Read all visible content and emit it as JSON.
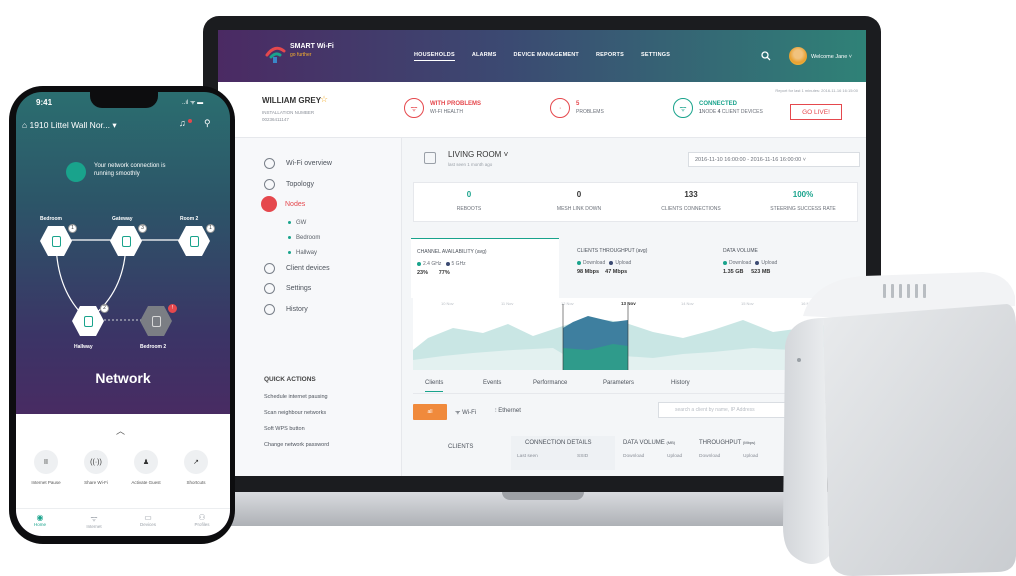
{
  "colors": {
    "accent": "#19a38c",
    "alert": "#e5484d",
    "brand_gradient_start": "#4b2a63",
    "brand_gradient_end": "#2f8277",
    "filter_orange": "#f08a3c"
  },
  "app": {
    "brand_name": "SMART Wi-Fi",
    "brand_tagline": "go further",
    "nav": [
      "HOUSEHOLDS",
      "ALARMS",
      "DEVICE MANAGEMENT",
      "REPORTS",
      "SETTINGS"
    ],
    "active_nav": "HOUSEHOLDS",
    "welcome": "Welcome Jane ˅",
    "search_icon": "search-icon"
  },
  "household": {
    "name": "WILLIAM GREY",
    "installation_label": "INSTALLATION NUMBER",
    "installation_number": "00236411147",
    "reported": "Report for last 1 minutes: 2016-11-16 16:15:00",
    "status_problems": {
      "title": "WITH PROBLEMS",
      "sub": "WI-FI HEALTH",
      "icon": "wifi-icon"
    },
    "status_count": {
      "title": "5",
      "sub": "PROBLEMS",
      "icon": "alert-icon"
    },
    "status_connected": {
      "title": "CONNECTED",
      "sub_nodes": "1",
      "sub_nodes_label": "NODE",
      "sub_clients": "4",
      "sub_clients_label": "CLIENT DEVICES",
      "icon": "wifi-icon"
    },
    "go_live": "GO LIVE!"
  },
  "sidebar": {
    "items": [
      {
        "label": "Wi-Fi overview",
        "icon": "clock-icon"
      },
      {
        "label": "Topology",
        "icon": "topology-icon"
      },
      {
        "label": "Nodes",
        "icon": "node-icon"
      },
      {
        "label": "Client devices",
        "icon": "phone-icon"
      },
      {
        "label": "Settings",
        "icon": "sliders-icon"
      },
      {
        "label": "History",
        "icon": "history-icon"
      }
    ],
    "active": "Nodes",
    "node_children": [
      "GW",
      "Bedroom",
      "Hallway"
    ],
    "quick_actions_title": "QUICK ACTIONS",
    "quick_actions": [
      "Schedule internet pausing",
      "Scan neighbour networks",
      "Soft WPS button",
      "Change network password"
    ]
  },
  "room": {
    "icon_label": "router",
    "name": "LIVING ROOM ˅",
    "last_seen": "last seen 1 month ago",
    "date_range": "2016-11-10 16:00:00 - 2016-11-16 16:00:00 ˅"
  },
  "kpis": [
    {
      "value": "0",
      "label": "REBOOTS"
    },
    {
      "value": "0",
      "label": "MESH LINK DOWN"
    },
    {
      "value": "133",
      "label": "CLIENTS CONNECTIONS"
    },
    {
      "value": "100%",
      "label": "STEERING SUCCESS RATE"
    }
  ],
  "charts": [
    {
      "title": "CHANNEL AVAILABILITY (avg)",
      "legend": [
        "2.4 GHz",
        "5 GHz"
      ],
      "values": [
        "23%",
        "77%"
      ]
    },
    {
      "title": "CLIENTS THROUGHPUT (avg)",
      "legend": [
        "Download",
        "Upload"
      ],
      "values": [
        "98 Mbps",
        "47 Mbps"
      ]
    },
    {
      "title": "DATA VOLUME",
      "legend": [
        "Download",
        "Upload"
      ],
      "values": [
        "1.35 GB",
        "523 MB"
      ]
    }
  ],
  "chart_ticks": [
    "10 Nov",
    "11 Nov",
    "12 Nov",
    "13 Nov",
    "14 Nov",
    "15 Nov",
    "16 Nov"
  ],
  "chart_highlight_tick": "13 Nov",
  "subtabs": [
    "Clients",
    "Events",
    "Performance",
    "Parameters",
    "History"
  ],
  "filters": {
    "all": "all",
    "wifi": "Wi-Fi",
    "ethernet": "Ethernet"
  },
  "table_search_placeholder": "search a client by name, IP Address",
  "table": {
    "clients_header": "CLIENTS",
    "groups": [
      {
        "title": "CONNECTION DETAILS",
        "cols": [
          "Last seen",
          "SSID"
        ]
      },
      {
        "title": "DATA VOLUME",
        "unit": "(MB)",
        "cols": [
          "Download",
          "Upload"
        ]
      },
      {
        "title": "THROUGHPUT",
        "unit": "(Mbps)",
        "cols": [
          "Download",
          "Upload"
        ]
      }
    ]
  },
  "phone": {
    "time": "9:41",
    "signal": "..ıl ᯤ ▬",
    "address": "1910 Littel Wall Nor... ▾",
    "status_line": "Your network connection is running smoothly",
    "nodes": [
      {
        "label": "Bedroom",
        "badge": "1"
      },
      {
        "label": "Gateway",
        "badge": "3"
      },
      {
        "label": "Room 2",
        "badge": "1"
      },
      {
        "label": "Hallway",
        "badge": "2"
      },
      {
        "label": "Bedroom 2",
        "badge": "!"
      }
    ],
    "network_title": "Network",
    "actions": [
      {
        "label": "Internet Pause",
        "icon": "pause-icon",
        "glyph": "II"
      },
      {
        "label": "Share Wi-Fi",
        "icon": "share-wifi-icon",
        "glyph": "((·))"
      },
      {
        "label": "Activate Guest",
        "icon": "guest-icon",
        "glyph": "♟"
      },
      {
        "label": "Shortcuts",
        "icon": "shortcut-icon",
        "glyph": "↗"
      }
    ],
    "tabs": [
      {
        "label": "Home",
        "glyph": "◉"
      },
      {
        "label": "Internet",
        "glyph": "ᯤ"
      },
      {
        "label": "Devices",
        "glyph": "▭"
      },
      {
        "label": "Profiles",
        "glyph": "⚇"
      }
    ],
    "active_tab": "Home"
  }
}
